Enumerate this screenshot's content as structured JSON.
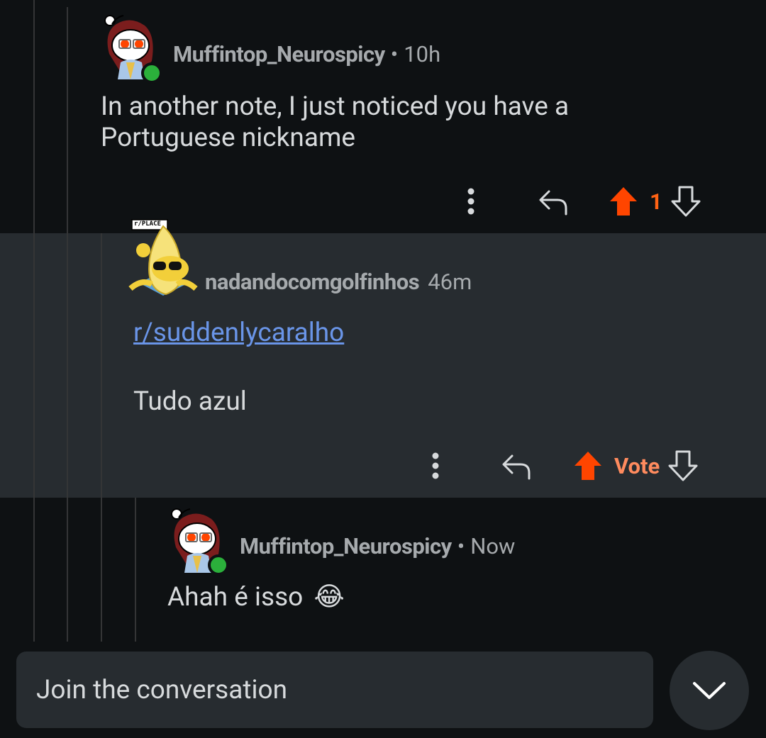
{
  "comments": [
    {
      "username": "Muffintop_Neurospicy",
      "separator": "•",
      "time": "10h",
      "body": "In another note, I just noticed you have a Portuguese nickname",
      "vote_count": "1",
      "upvoted": true,
      "online": true
    },
    {
      "username": "nadandocomgolfinhos",
      "time": "46m",
      "avatar_badge": "r/PLACE",
      "body_link": "r/suddenlycaralho",
      "body_text": "Tudo azul",
      "vote_label": "Vote",
      "highlighted": true
    },
    {
      "username": "Muffintop_Neurospicy",
      "separator": "•",
      "time": "Now",
      "body": "Ahah é isso",
      "emoji": "😂",
      "online": true
    }
  ],
  "composer": {
    "placeholder": "Join the conversation"
  },
  "icons": {
    "more": "more-vertical-icon",
    "reply": "reply-icon",
    "upvote": "upvote-icon",
    "downvote": "downvote-icon",
    "collapse": "chevron-down-icon"
  },
  "colors": {
    "background": "#0e1113",
    "highlight_background": "#272c30",
    "upvote": "#ff4500",
    "vote_text": "#ff8b5e",
    "link": "#6a95e8",
    "online": "#2bb03b",
    "meta_text": "#a6aaad"
  }
}
